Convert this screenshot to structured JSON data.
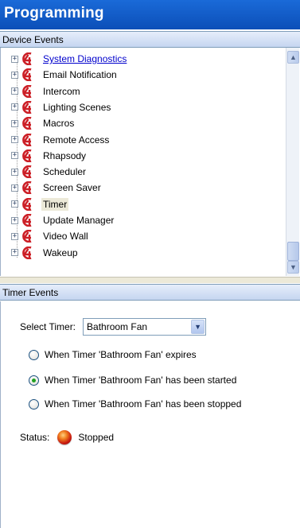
{
  "title": "Programming",
  "device_events": {
    "header": "Device Events",
    "items": [
      {
        "label": "System Diagnostics",
        "state": "link"
      },
      {
        "label": "Email Notification",
        "state": ""
      },
      {
        "label": "Intercom",
        "state": ""
      },
      {
        "label": "Lighting Scenes",
        "state": ""
      },
      {
        "label": "Macros",
        "state": ""
      },
      {
        "label": "Remote Access",
        "state": ""
      },
      {
        "label": "Rhapsody",
        "state": ""
      },
      {
        "label": "Scheduler",
        "state": ""
      },
      {
        "label": "Screen Saver",
        "state": ""
      },
      {
        "label": "Timer",
        "state": "selected"
      },
      {
        "label": "Update Manager",
        "state": ""
      },
      {
        "label": "Video Wall",
        "state": ""
      },
      {
        "label": "Wakeup",
        "state": ""
      }
    ],
    "expander_glyph": "+",
    "icon": "c4-logo-icon",
    "icon_color": "#cc1f26"
  },
  "timer_events": {
    "header": "Timer Events",
    "select_label": "Select Timer:",
    "select_value": "Bathroom Fan",
    "options": [
      {
        "label": "When Timer 'Bathroom Fan' expires",
        "checked": false
      },
      {
        "label": "When Timer 'Bathroom Fan' has been started",
        "checked": true
      },
      {
        "label": "When Timer 'Bathroom Fan' has been stopped",
        "checked": false
      }
    ],
    "status_label": "Status:",
    "status_value": "Stopped",
    "status_color": "#d0281a"
  },
  "colors": {
    "title_bar": "#0c4fb8",
    "link": "#0000cc",
    "selected_bg": "#ece9d8"
  }
}
